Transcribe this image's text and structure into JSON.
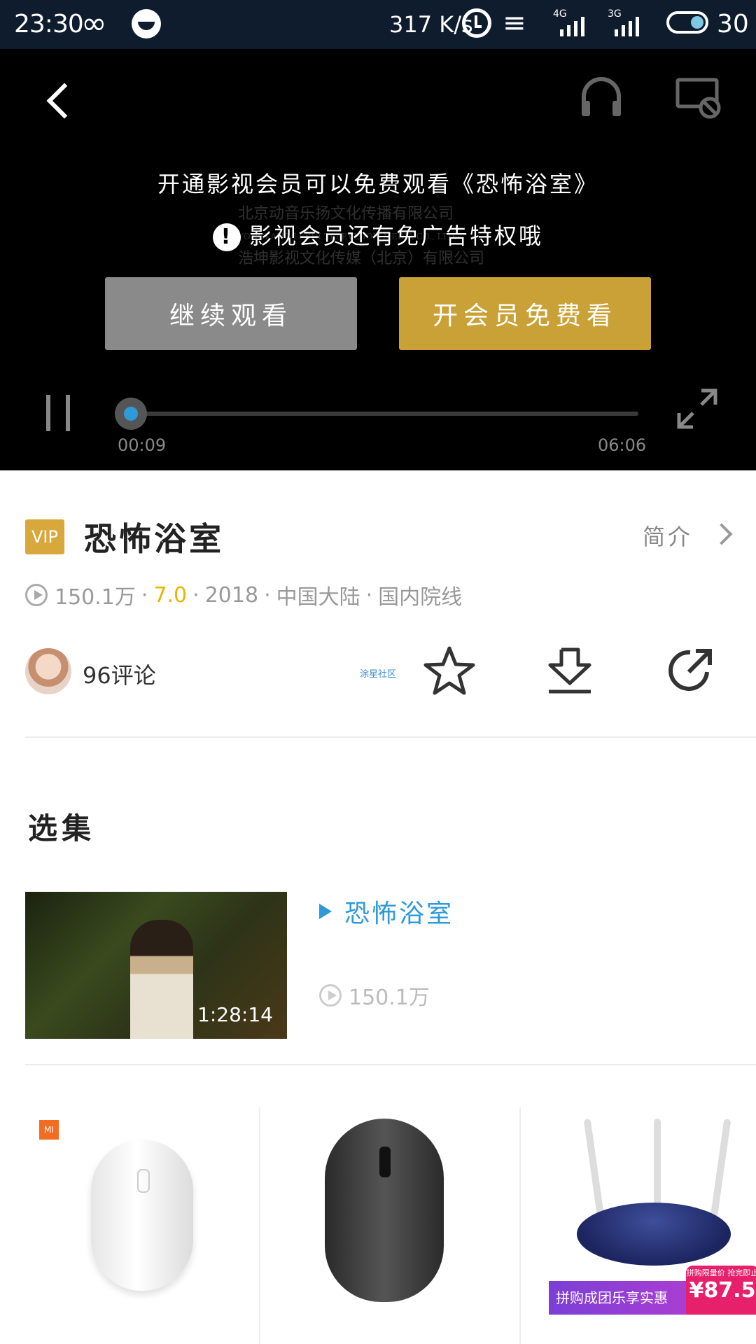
{
  "status_bar": {
    "time": "23:30",
    "speed": "317 K/s",
    "net1": "4G",
    "net2": "3G",
    "battery": "30"
  },
  "player": {
    "prompt_line1": "开通影视会员可以免费观看《恐怖浴室》",
    "prompt_line2": "影视会员还有免广告特权哦",
    "continue_label": "继续观看",
    "vip_label": "开会员免费看",
    "current_time": "00:09",
    "total_time": "06:06",
    "progress": 0.025,
    "watermark": [
      "北京动音乐扬文化传播有限公司",
      "YONGKANG LESHI TELEVISION MEDIA CO., LTD.",
      "浩坤影视文化传媒（北京）有限公司"
    ]
  },
  "movie": {
    "badge": "VIP",
    "title": "恐怖浴室",
    "intro_label": "简介",
    "views": "150.1万",
    "score": "7.0",
    "year": "2018",
    "region": "中国大陆",
    "category": "国内院线",
    "separator": "·",
    "comments": "96评论",
    "community": "涂星社区"
  },
  "episodes": {
    "section_title": "选集",
    "items": [
      {
        "title": "恐怖浴室",
        "views": "150.1万",
        "duration": "1:28:14"
      }
    ]
  },
  "products": [
    {
      "brand_badge": "MI"
    },
    {
      "brand_badge": ""
    },
    {
      "promo_text": "拼购成团乐享实惠",
      "promo_small": "拼购限量价 抢完即止",
      "promo_price": "¥87.5"
    }
  ],
  "colors": {
    "status_bg": "#0f1c2e",
    "vip_gold": "#c9a136",
    "accent_blue": "#2e9ad8",
    "score_yellow": "#e8b500"
  }
}
